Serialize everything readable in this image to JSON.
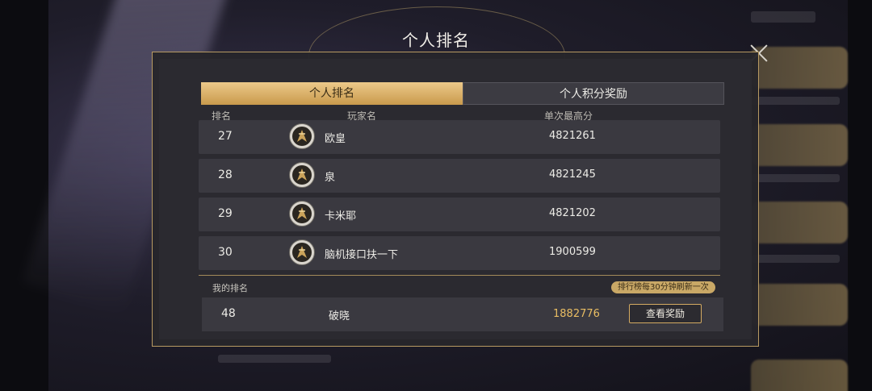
{
  "title": "个人排名",
  "tabs": [
    {
      "label": "个人排名",
      "active": true
    },
    {
      "label": "个人积分奖励",
      "active": false
    }
  ],
  "columns": {
    "rank": "排名",
    "player": "玩家名",
    "score": "单次最高分"
  },
  "rows": [
    {
      "rank": "27",
      "name": "欧皇",
      "score": "4821261"
    },
    {
      "rank": "28",
      "name": "泉",
      "score": "4821245"
    },
    {
      "rank": "29",
      "name": "卡米耶",
      "score": "4821202"
    },
    {
      "rank": "30",
      "name": "脑机接口扶一下",
      "score": "1900599"
    }
  ],
  "my_rank": {
    "label": "我的排名",
    "notice": "排行榜每30分钟刷新一次",
    "rank": "48",
    "name": "破晓",
    "score": "1882776",
    "button": "查看奖励"
  },
  "colors": {
    "accent_gold": "#c99a4c",
    "score_gold": "#e9bd63",
    "panel": "#2b2a30"
  }
}
